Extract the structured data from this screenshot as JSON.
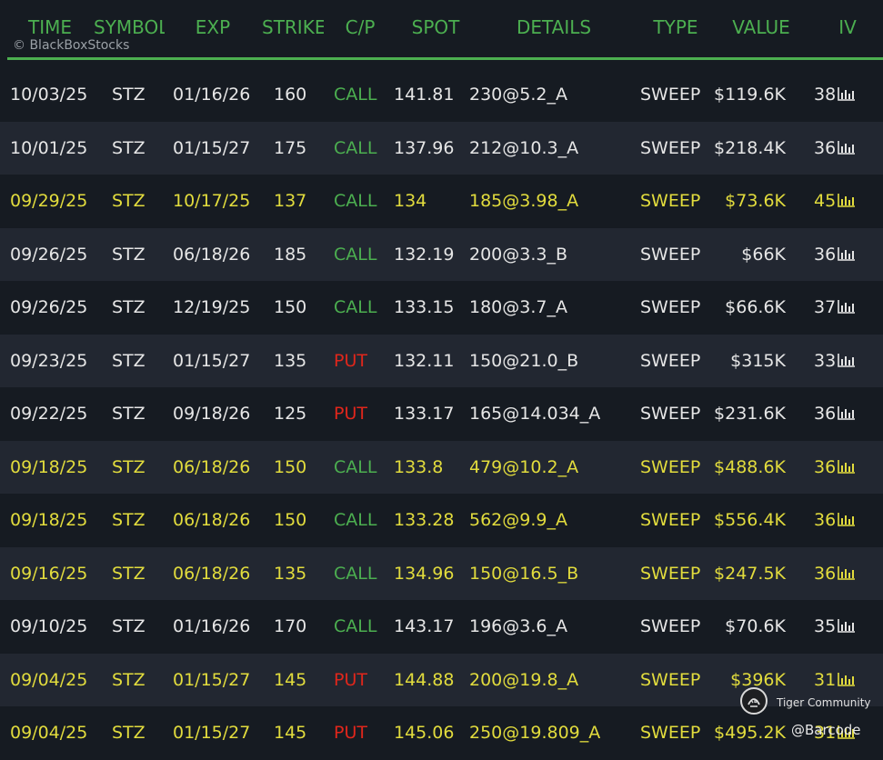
{
  "header": {
    "columns": [
      "TIME",
      "SYMBOL",
      "EXP",
      "STRIKE",
      "C/P",
      "SPOT",
      "DETAILS",
      "TYPE",
      "VALUE",
      "IV"
    ],
    "watermark": "© BlackBoxStocks"
  },
  "colors": {
    "accent_green": "#4caf50",
    "put_red": "#e0261b",
    "highlight_yellow": "#e2dc3d",
    "text_white": "#e6e6e6"
  },
  "rows": [
    {
      "time": "10/03/25",
      "symbol": "STZ",
      "exp": "01/16/26",
      "strike": "160",
      "cp": "CALL",
      "spot": "141.81",
      "details": "230@5.2_A",
      "type": "SWEEP",
      "value": "$119.6K",
      "iv": "38",
      "highlight": false
    },
    {
      "time": "10/01/25",
      "symbol": "STZ",
      "exp": "01/15/27",
      "strike": "175",
      "cp": "CALL",
      "spot": "137.96",
      "details": "212@10.3_A",
      "type": "SWEEP",
      "value": "$218.4K",
      "iv": "36",
      "highlight": false
    },
    {
      "time": "09/29/25",
      "symbol": "STZ",
      "exp": "10/17/25",
      "strike": "137",
      "cp": "CALL",
      "spot": "134",
      "details": "185@3.98_A",
      "type": "SWEEP",
      "value": "$73.6K",
      "iv": "45",
      "highlight": true
    },
    {
      "time": "09/26/25",
      "symbol": "STZ",
      "exp": "06/18/26",
      "strike": "185",
      "cp": "CALL",
      "spot": "132.19",
      "details": "200@3.3_B",
      "type": "SWEEP",
      "value": "$66K",
      "iv": "36",
      "highlight": false
    },
    {
      "time": "09/26/25",
      "symbol": "STZ",
      "exp": "12/19/25",
      "strike": "150",
      "cp": "CALL",
      "spot": "133.15",
      "details": "180@3.7_A",
      "type": "SWEEP",
      "value": "$66.6K",
      "iv": "37",
      "highlight": false
    },
    {
      "time": "09/23/25",
      "symbol": "STZ",
      "exp": "01/15/27",
      "strike": "135",
      "cp": "PUT",
      "spot": "132.11",
      "details": "150@21.0_B",
      "type": "SWEEP",
      "value": "$315K",
      "iv": "33",
      "highlight": false
    },
    {
      "time": "09/22/25",
      "symbol": "STZ",
      "exp": "09/18/26",
      "strike": "125",
      "cp": "PUT",
      "spot": "133.17",
      "details": "165@14.034_A",
      "type": "SWEEP",
      "value": "$231.6K",
      "iv": "36",
      "highlight": false
    },
    {
      "time": "09/18/25",
      "symbol": "STZ",
      "exp": "06/18/26",
      "strike": "150",
      "cp": "CALL",
      "spot": "133.8",
      "details": "479@10.2_A",
      "type": "SWEEP",
      "value": "$488.6K",
      "iv": "36",
      "highlight": true
    },
    {
      "time": "09/18/25",
      "symbol": "STZ",
      "exp": "06/18/26",
      "strike": "150",
      "cp": "CALL",
      "spot": "133.28",
      "details": "562@9.9_A",
      "type": "SWEEP",
      "value": "$556.4K",
      "iv": "36",
      "highlight": true
    },
    {
      "time": "09/16/25",
      "symbol": "STZ",
      "exp": "06/18/26",
      "strike": "135",
      "cp": "CALL",
      "spot": "134.96",
      "details": "150@16.5_B",
      "type": "SWEEP",
      "value": "$247.5K",
      "iv": "36",
      "highlight": true
    },
    {
      "time": "09/10/25",
      "symbol": "STZ",
      "exp": "01/16/26",
      "strike": "170",
      "cp": "CALL",
      "spot": "143.17",
      "details": "196@3.6_A",
      "type": "SWEEP",
      "value": "$70.6K",
      "iv": "35",
      "highlight": false
    },
    {
      "time": "09/04/25",
      "symbol": "STZ",
      "exp": "01/15/27",
      "strike": "145",
      "cp": "PUT",
      "spot": "144.88",
      "details": "200@19.8_A",
      "type": "SWEEP",
      "value": "$396K",
      "iv": "31",
      "highlight": true
    },
    {
      "time": "09/04/25",
      "symbol": "STZ",
      "exp": "01/15/27",
      "strike": "145",
      "cp": "PUT",
      "spot": "145.06",
      "details": "250@19.809_A",
      "type": "SWEEP",
      "value": "$495.2K",
      "iv": "31",
      "highlight": true
    }
  ],
  "overlay": {
    "brand": "Tiger Community",
    "handle": "@Barcode",
    "icon": "tiger-community-logo-icon"
  }
}
